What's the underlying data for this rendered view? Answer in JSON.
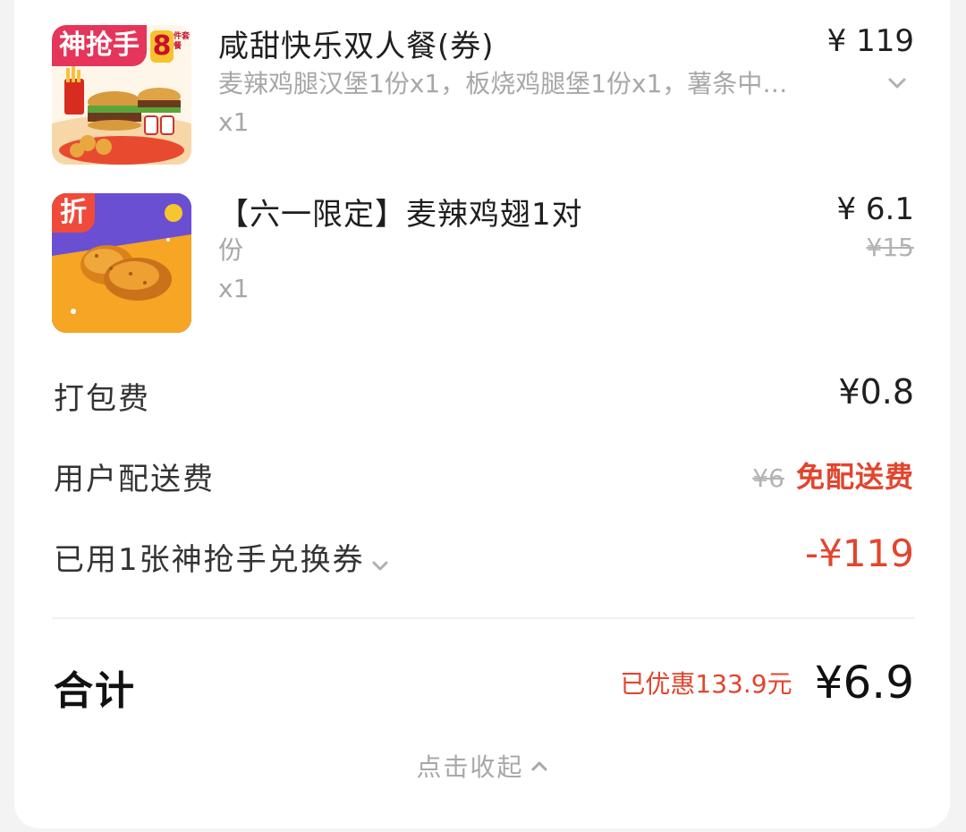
{
  "order_items": [
    {
      "title": "咸甜快乐双人餐(券)",
      "desc": "麦辣鸡腿汉堡1份x1，板烧鸡腿堡1份x1，薯条中…",
      "qty": "x1",
      "price": "¥ 119",
      "badge": "神抢手",
      "badge_num": "8",
      "badge_sub": "件套餐",
      "image_icon": "burger-combo-image"
    },
    {
      "title": "【六一限定】麦辣鸡翅1对",
      "title_wrap": "份",
      "qty": "x1",
      "price": "¥ 6.1",
      "original_price": "¥15",
      "badge": "折",
      "image_icon": "chicken-wings-image"
    }
  ],
  "fees": {
    "packing": {
      "label": "打包费",
      "value": "¥0.8"
    },
    "delivery": {
      "label": "用户配送费",
      "original": "¥6",
      "value": "免配送费"
    },
    "coupon": {
      "label": "已用1张神抢手兑换券",
      "value": "-¥119"
    }
  },
  "total": {
    "label": "合计",
    "saved": "已优惠133.9元",
    "value": "¥6.9"
  },
  "collapse_label": "点击收起",
  "colors": {
    "accent_red": "#e2452d",
    "muted": "#a7a7a7",
    "card": "#ffffff",
    "bg": "#f3f3f3"
  }
}
